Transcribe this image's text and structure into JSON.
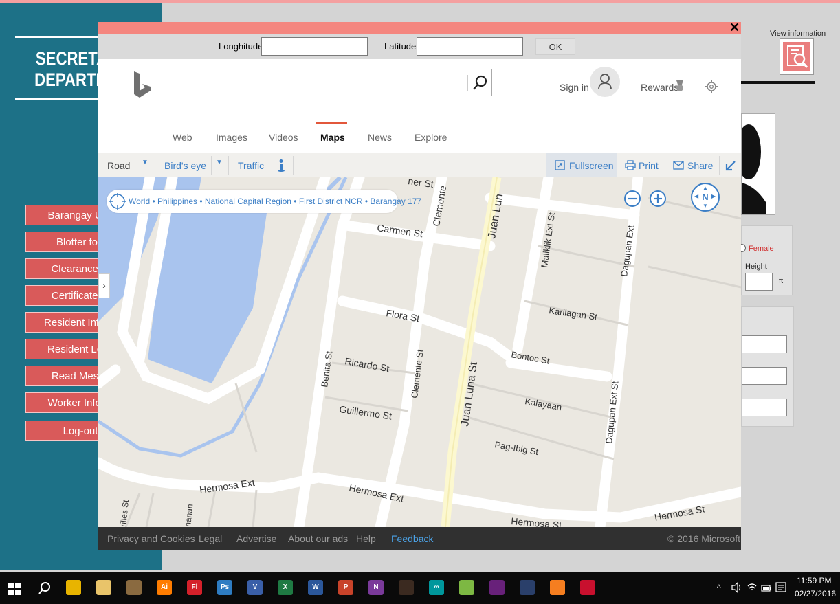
{
  "background_app": {
    "sidebar_title_line1": "SECRETA",
    "sidebar_title_line2": "DEPARTM",
    "nav": [
      "Barangay Upc",
      "Blotter forr",
      "Clearance fo",
      "Certificate fo",
      "Resident Inform",
      "Resident Loca",
      "Read Messa",
      "Worker Inform",
      "Log-out"
    ],
    "view_info_label": "View information",
    "female_label": "Female",
    "height_label": "Height",
    "height_unit": "ft"
  },
  "popup": {
    "close": "✕",
    "longitude_label": "Longhitude:",
    "longitude_value": "",
    "latitude_label": "Latitude:",
    "latitude_value": "",
    "ok_label": "OK",
    "bing": {
      "search_value": "",
      "sign_in": "Sign in",
      "rewards": "Rewards",
      "tabs": [
        "Web",
        "Images",
        "Videos",
        "Maps",
        "News",
        "Explore"
      ],
      "active_tab": "Maps"
    },
    "toolbar": {
      "road": "Road",
      "birds_eye": "Bird's eye",
      "traffic": "Traffic",
      "fullscreen": "Fullscreen",
      "print": "Print",
      "share": "Share"
    },
    "map": {
      "breadcrumb": "World • Philippines • National Capital Region • First District NCR • Barangay 177",
      "compass": "N",
      "streets": [
        "Carmen St",
        "Clemente",
        "Juan Lun",
        "Maliklik Ext St",
        "Dagupan Ext",
        "Flora St",
        "Karilagan St",
        "Benita St",
        "Ricardo St",
        "Clemente St",
        "Juan Luna St",
        "Bontoc St",
        "Dagupan Ext St",
        "Kalayaan",
        "Guillermo St",
        "Pag-Ibig St",
        "Hermosa Ext",
        "Hermosa Ext",
        "Hermosa St",
        "Hermosa St",
        "rilles St",
        "nanan",
        "ner St"
      ]
    },
    "footer": {
      "links": [
        "Privacy and Cookies",
        "Legal",
        "Advertise",
        "About our ads",
        "Help",
        "Feedback"
      ],
      "copyright": "© 2016 Microsoft"
    }
  },
  "taskbar": {
    "time": "11:59 PM",
    "date": "02/27/2016",
    "apps": [
      {
        "name": "chrome-icon",
        "label": "",
        "color": "#e8b400"
      },
      {
        "name": "file-explorer-icon",
        "label": "",
        "color": "#e9c46a"
      },
      {
        "name": "app-icon",
        "label": "",
        "color": "#8a6a40"
      },
      {
        "name": "illustrator-icon",
        "label": "Ai",
        "color": "#ff7c00"
      },
      {
        "name": "flash-icon",
        "label": "Fl",
        "color": "#d4202a"
      },
      {
        "name": "photoshop-icon",
        "label": "Ps",
        "color": "#2e7cc2"
      },
      {
        "name": "visio-icon",
        "label": "V",
        "color": "#3a5fa8"
      },
      {
        "name": "excel-icon",
        "label": "X",
        "color": "#1f7a43"
      },
      {
        "name": "word-icon",
        "label": "W",
        "color": "#2b579a"
      },
      {
        "name": "powerpoint-icon",
        "label": "P",
        "color": "#c8432a"
      },
      {
        "name": "onenote-icon",
        "label": "N",
        "color": "#7a3a9a"
      },
      {
        "name": "profile-icon",
        "label": "",
        "color": "#3b2a20"
      },
      {
        "name": "arduino-icon",
        "label": "∞",
        "color": "#00979c"
      },
      {
        "name": "android-studio-icon",
        "label": "",
        "color": "#7db843"
      },
      {
        "name": "visual-studio-icon",
        "label": "",
        "color": "#68217a"
      },
      {
        "name": "dev-icon",
        "label": "",
        "color": "#2a3f6a"
      },
      {
        "name": "xampp-icon",
        "label": "",
        "color": "#f57e20"
      },
      {
        "name": "opera-icon",
        "label": "",
        "color": "#c8102e"
      }
    ]
  }
}
